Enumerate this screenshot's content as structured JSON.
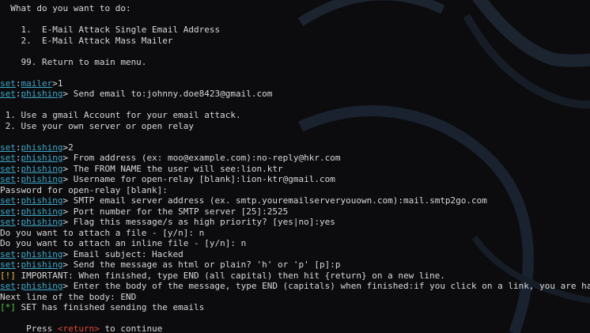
{
  "terminal": {
    "prompt_name": "set",
    "lines": [
      {
        "kind": "text",
        "text": "  What do you want to do:"
      },
      {
        "kind": "text",
        "text": ""
      },
      {
        "kind": "text",
        "text": "    1.  E-Mail Attack Single Email Address"
      },
      {
        "kind": "text",
        "text": "    2.  E-Mail Attack Mass Mailer"
      },
      {
        "kind": "text",
        "text": ""
      },
      {
        "kind": "text",
        "text": "    99. Return to main menu."
      },
      {
        "kind": "text",
        "text": ""
      },
      {
        "kind": "prompt",
        "module": "mailer",
        "sep": ">",
        "text": "1"
      },
      {
        "kind": "prompt",
        "module": "phishing",
        "sep": "> ",
        "text": "Send email to:johnny.doe8423@gmail.com"
      },
      {
        "kind": "text",
        "text": ""
      },
      {
        "kind": "text",
        "text": " 1. Use a gmail Account for your email attack."
      },
      {
        "kind": "text",
        "text": " 2. Use your own server or open relay"
      },
      {
        "kind": "text",
        "text": ""
      },
      {
        "kind": "prompt",
        "module": "phishing",
        "sep": ">",
        "text": "2"
      },
      {
        "kind": "prompt",
        "module": "phishing",
        "sep": "> ",
        "text": "From address (ex: moo@example.com):no-reply@hkr.com"
      },
      {
        "kind": "prompt",
        "module": "phishing",
        "sep": "> ",
        "text": "The FROM NAME the user will see:lion.ktr"
      },
      {
        "kind": "prompt",
        "module": "phishing",
        "sep": "> ",
        "text": "Username for open-relay [blank]:lion-ktr@gmail.com"
      },
      {
        "kind": "text",
        "text": "Password for open-relay [blank]:"
      },
      {
        "kind": "prompt",
        "module": "phishing",
        "sep": "> ",
        "text": "SMTP email server address (ex. smtp.youremailserveryouown.com):mail.smtp2go.com"
      },
      {
        "kind": "prompt",
        "module": "phishing",
        "sep": "> ",
        "text": "Port number for the SMTP server [25]:2525"
      },
      {
        "kind": "prompt",
        "module": "phishing",
        "sep": "> ",
        "text": "Flag this message/s as high priority? [yes|no]:yes"
      },
      {
        "kind": "text",
        "text": "Do you want to attach a file - [y/n]: n"
      },
      {
        "kind": "text",
        "text": "Do you want to attach an inline file - [y/n]: n"
      },
      {
        "kind": "prompt",
        "module": "phishing",
        "sep": "> ",
        "text": "Email subject: Hacked"
      },
      {
        "kind": "prompt",
        "module": "phishing",
        "sep": "> ",
        "text": "Send the message as html or plain? 'h' or 'p' [p]:p"
      },
      {
        "kind": "tagged",
        "tag": "[!]",
        "tag_style": "warn",
        "text": " IMPORTANT: When finished, type END (all capital) then hit {return} on a new line."
      },
      {
        "kind": "prompt",
        "module": "phishing",
        "sep": "> ",
        "text": "Enter the body of the message, type END (capitals) when finished:if you click on a link, you are hacked."
      },
      {
        "kind": "text",
        "text": "Next line of the body: END"
      },
      {
        "kind": "tagged",
        "tag": "[*]",
        "tag_style": "ok",
        "text": " SET has finished sending the emails"
      },
      {
        "kind": "text",
        "text": ""
      },
      {
        "kind": "press",
        "before": "     Press ",
        "key": "<return>",
        "after": " to continue"
      }
    ]
  },
  "colors": {
    "background": "#0c0c0e",
    "text": "#d8d8d8",
    "prompt_cyan": "#3fa7c8",
    "warn_yellow": "#e8c74a",
    "ok_green": "#58c84a",
    "return_red": "#e0483c"
  },
  "background_logo": "kali-dragon-watermark"
}
